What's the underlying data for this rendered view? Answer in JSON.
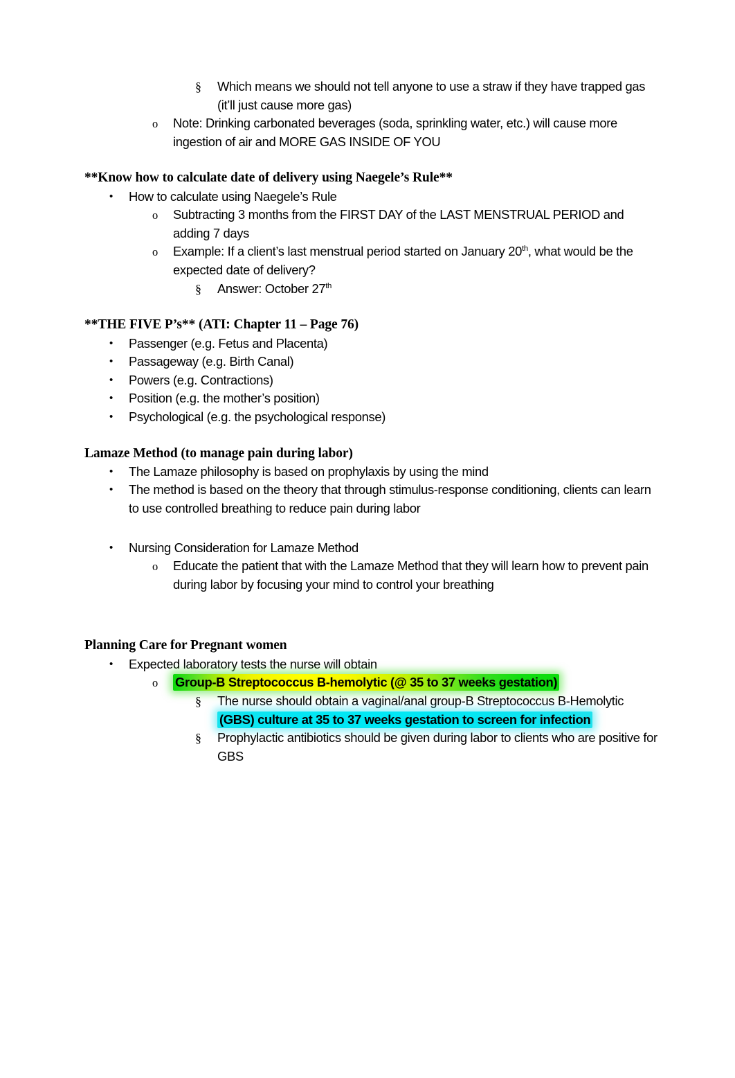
{
  "document": {
    "type": "study-notes",
    "page_background": "#ffffff",
    "text_color": "#000000",
    "highlight_colors": {
      "green": "#0ddd0d",
      "yellow": "#ffff00",
      "cyan": "#00e8f5"
    },
    "markers": {
      "bullet": "•",
      "circle": "o",
      "section": "§"
    },
    "blocks": [
      {
        "id": "straw-note",
        "kind": "list",
        "items": [
          {
            "level": 3,
            "marker": "§",
            "text": "Which means we should not tell anyone to use a straw if they have trapped gas (it’ll just cause more gas)"
          },
          {
            "level": 2,
            "marker": "o",
            "text": "Note: Drinking carbonated beverages (soda, sprinkling water, etc.) will cause more ingestion of air and MORE GAS INSIDE OF YOU"
          }
        ]
      },
      {
        "id": "naegele",
        "kind": "section",
        "heading": "**Know how to calculate date of delivery using Naegele’s Rule**",
        "items": [
          {
            "level": 1,
            "marker": "•",
            "text": "How to calculate using Naegele’s Rule"
          },
          {
            "level": 2,
            "marker": "o",
            "text": "Subtracting 3 months from the FIRST DAY of the LAST MENSTRUAL PERIOD and adding 7 days"
          },
          {
            "level": 2,
            "marker": "o",
            "text_before_sup": "Example: If a client’s last menstrual period started on January 20",
            "sup": "th",
            "text_after_sup": ", what would be the expected date of delivery?"
          },
          {
            "level": 3,
            "marker": "§",
            "text_before_sup": "Answer: October 27",
            "sup": "th",
            "text_after_sup": ""
          }
        ]
      },
      {
        "id": "five-ps",
        "kind": "section",
        "heading": "**THE FIVE P’s** (ATI: Chapter 11 – Page 76)",
        "items": [
          {
            "level": 1,
            "marker": "•",
            "text": "Passenger (e.g. Fetus and Placenta)"
          },
          {
            "level": 1,
            "marker": "•",
            "text": "Passageway (e.g. Birth Canal)"
          },
          {
            "level": 1,
            "marker": "•",
            "text": "Powers (e.g. Contractions)"
          },
          {
            "level": 1,
            "marker": "•",
            "text": "Position (e.g. the mother’s position)"
          },
          {
            "level": 1,
            "marker": "•",
            "text": "Psychological (e.g. the psychological response)"
          }
        ]
      },
      {
        "id": "lamaze",
        "kind": "section",
        "heading": "Lamaze Method (to manage pain during labor)",
        "items": [
          {
            "level": 1,
            "marker": "•",
            "text": "The Lamaze philosophy is based on prophylaxis by using the mind"
          },
          {
            "level": 1,
            "marker": "•",
            "text": "The method is based on the theory that through stimulus-response conditioning, clients can learn to use controlled breathing to reduce pain during labor"
          },
          {
            "level": 1,
            "marker": "•",
            "text": "Nursing Consideration for Lamaze Method"
          },
          {
            "level": 2,
            "marker": "o",
            "text": "Educate the patient that with the Lamaze Method that they will learn how to prevent pain during labor by focusing your mind to control your breathing"
          }
        ]
      },
      {
        "id": "planning-care",
        "kind": "section",
        "heading": "Planning Care for Pregnant women",
        "items": [
          {
            "level": 1,
            "marker": "•",
            "text": "Expected laboratory tests the nurse will obtain"
          },
          {
            "level": 2,
            "marker": "o",
            "highlight": "green",
            "text": "Group-B Streptococcus B-hemolytic (@ 35 to 37 weeks gestation)"
          },
          {
            "level": 3,
            "marker": "§",
            "plain_prefix": "The nurse should obtain a vaginal/anal group-B Streptococcus B-Hemolytic ",
            "highlight": "cyan",
            "highlighted_text": "(GBS) culture at 35 to 37 weeks gestation to screen for infection"
          },
          {
            "level": 3,
            "marker": "§",
            "text": "Prophylactic antibiotics should be given during labor to clients who are positive for GBS"
          }
        ]
      }
    ]
  }
}
